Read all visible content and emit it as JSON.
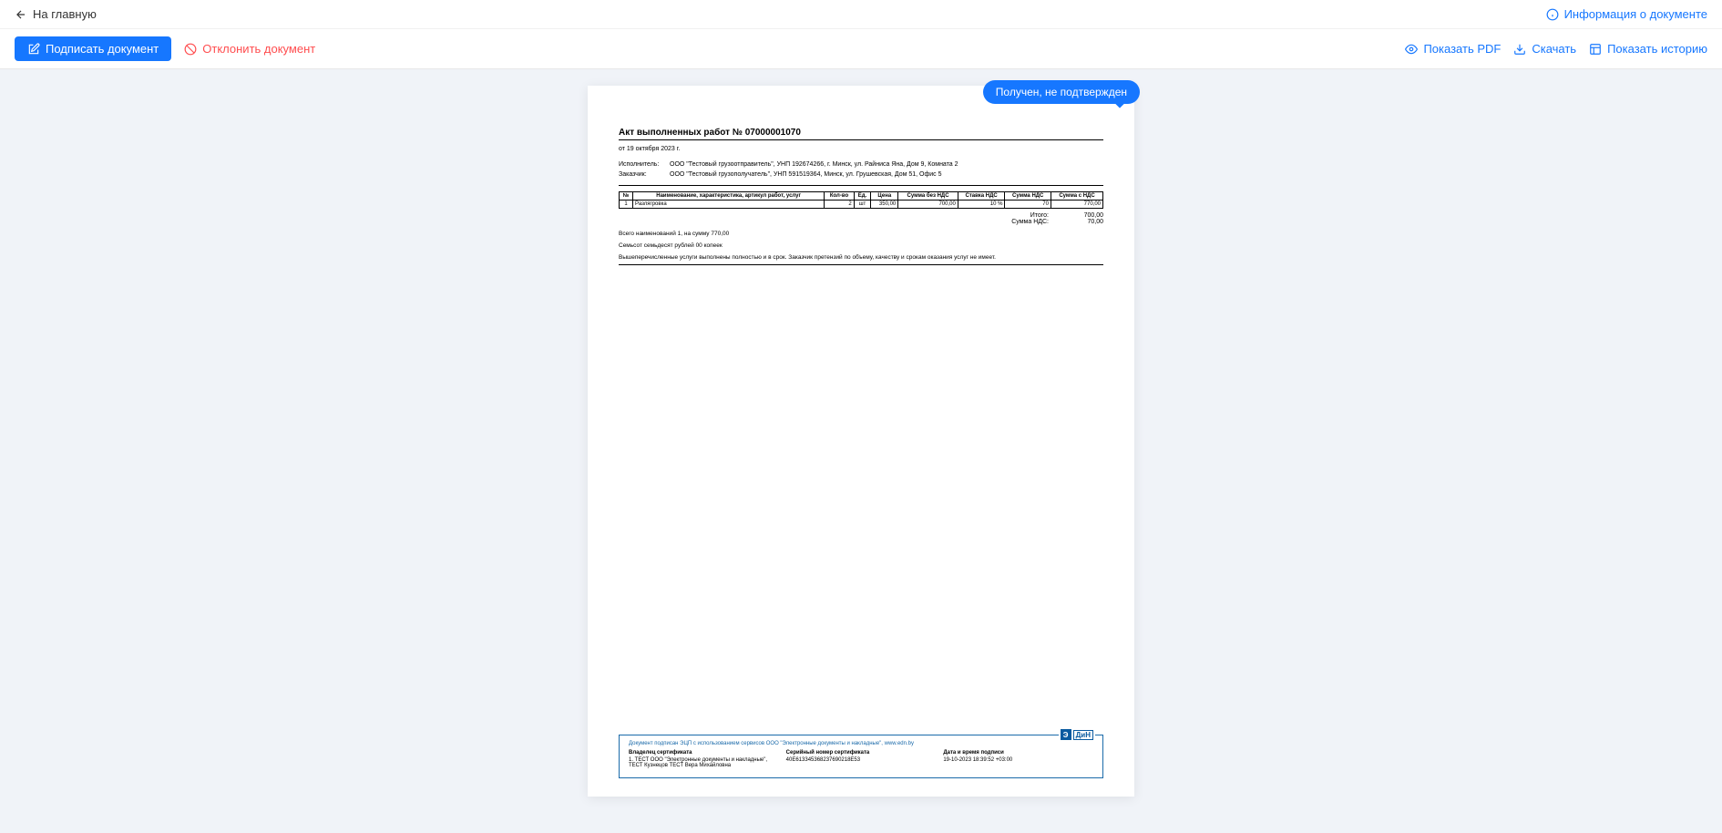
{
  "header": {
    "back_label": "На главную",
    "info_label": "Информация о документе",
    "sign_label": "Подписать документ",
    "reject_label": "Отклонить документ",
    "show_pdf_label": "Показать PDF",
    "download_label": "Скачать",
    "show_history_label": "Показать историю"
  },
  "status": "Получен, не подтвержден",
  "doc": {
    "title": "Акт выполненных работ № 07000001070",
    "date": "от 19 октября 2023 г.",
    "executor_label": "Исполнитель:",
    "executor_value": "ООО \"Тестовый грузоотправитель\", УНП 192674266, г. Минск, ул. Райниса Яна, Дом 9, Комната 2",
    "customer_label": "Заказчик:",
    "customer_value": "ООО \"Тестовый грузополучатель\", УНП 591519364, Минск, ул. Грушевская, Дом 51, Офис 5",
    "table_headers": [
      "№",
      "Наименование, характеристика, артикул работ, услуг",
      "Кол-во",
      "Ед.",
      "Цена",
      "Сумма без НДС",
      "Ставка НДС",
      "Сумма НДС",
      "Сумма с НДС"
    ],
    "table_row": {
      "n": "1",
      "name": "Разлягровка",
      "qty": "2",
      "unit": "шт",
      "price": "350,00",
      "sum_no_vat": "700,00",
      "vat_rate": "10 %",
      "vat_sum": "70",
      "sum_vat": "770,00"
    },
    "total_label": "Итого:",
    "total_value": "700,00",
    "vat_total_label": "Сумма НДС:",
    "vat_total_value": "70,00",
    "summary": "Всего наименований 1, на сумму 770,00",
    "summary_words": "Семьсот семьдесят рублей 00 копеек",
    "note": "Вышеперечисленные услуги выполнены полностью и в срок. Заказчик претензий по объему, качеству и срокам оказания услуг не имеет."
  },
  "signature": {
    "header": "Документ подписан ЭЦП с использованием сервисов ООО \"Электронные документы и накладные\", www.edn.by",
    "owner_label": "Владелец сертификата",
    "owner_value": "1. ТЕСТ ООО \"Электронные документы и накладные\", ТЕСТ Кузнецов ТЕСТ Вера Михайловна",
    "serial_label": "Серийный номер сертификата",
    "serial_value": "40E613345368237690218E53",
    "date_label": "Дата и время подписи",
    "date_value": "19-10-2023 18:39:52 +03:00"
  }
}
